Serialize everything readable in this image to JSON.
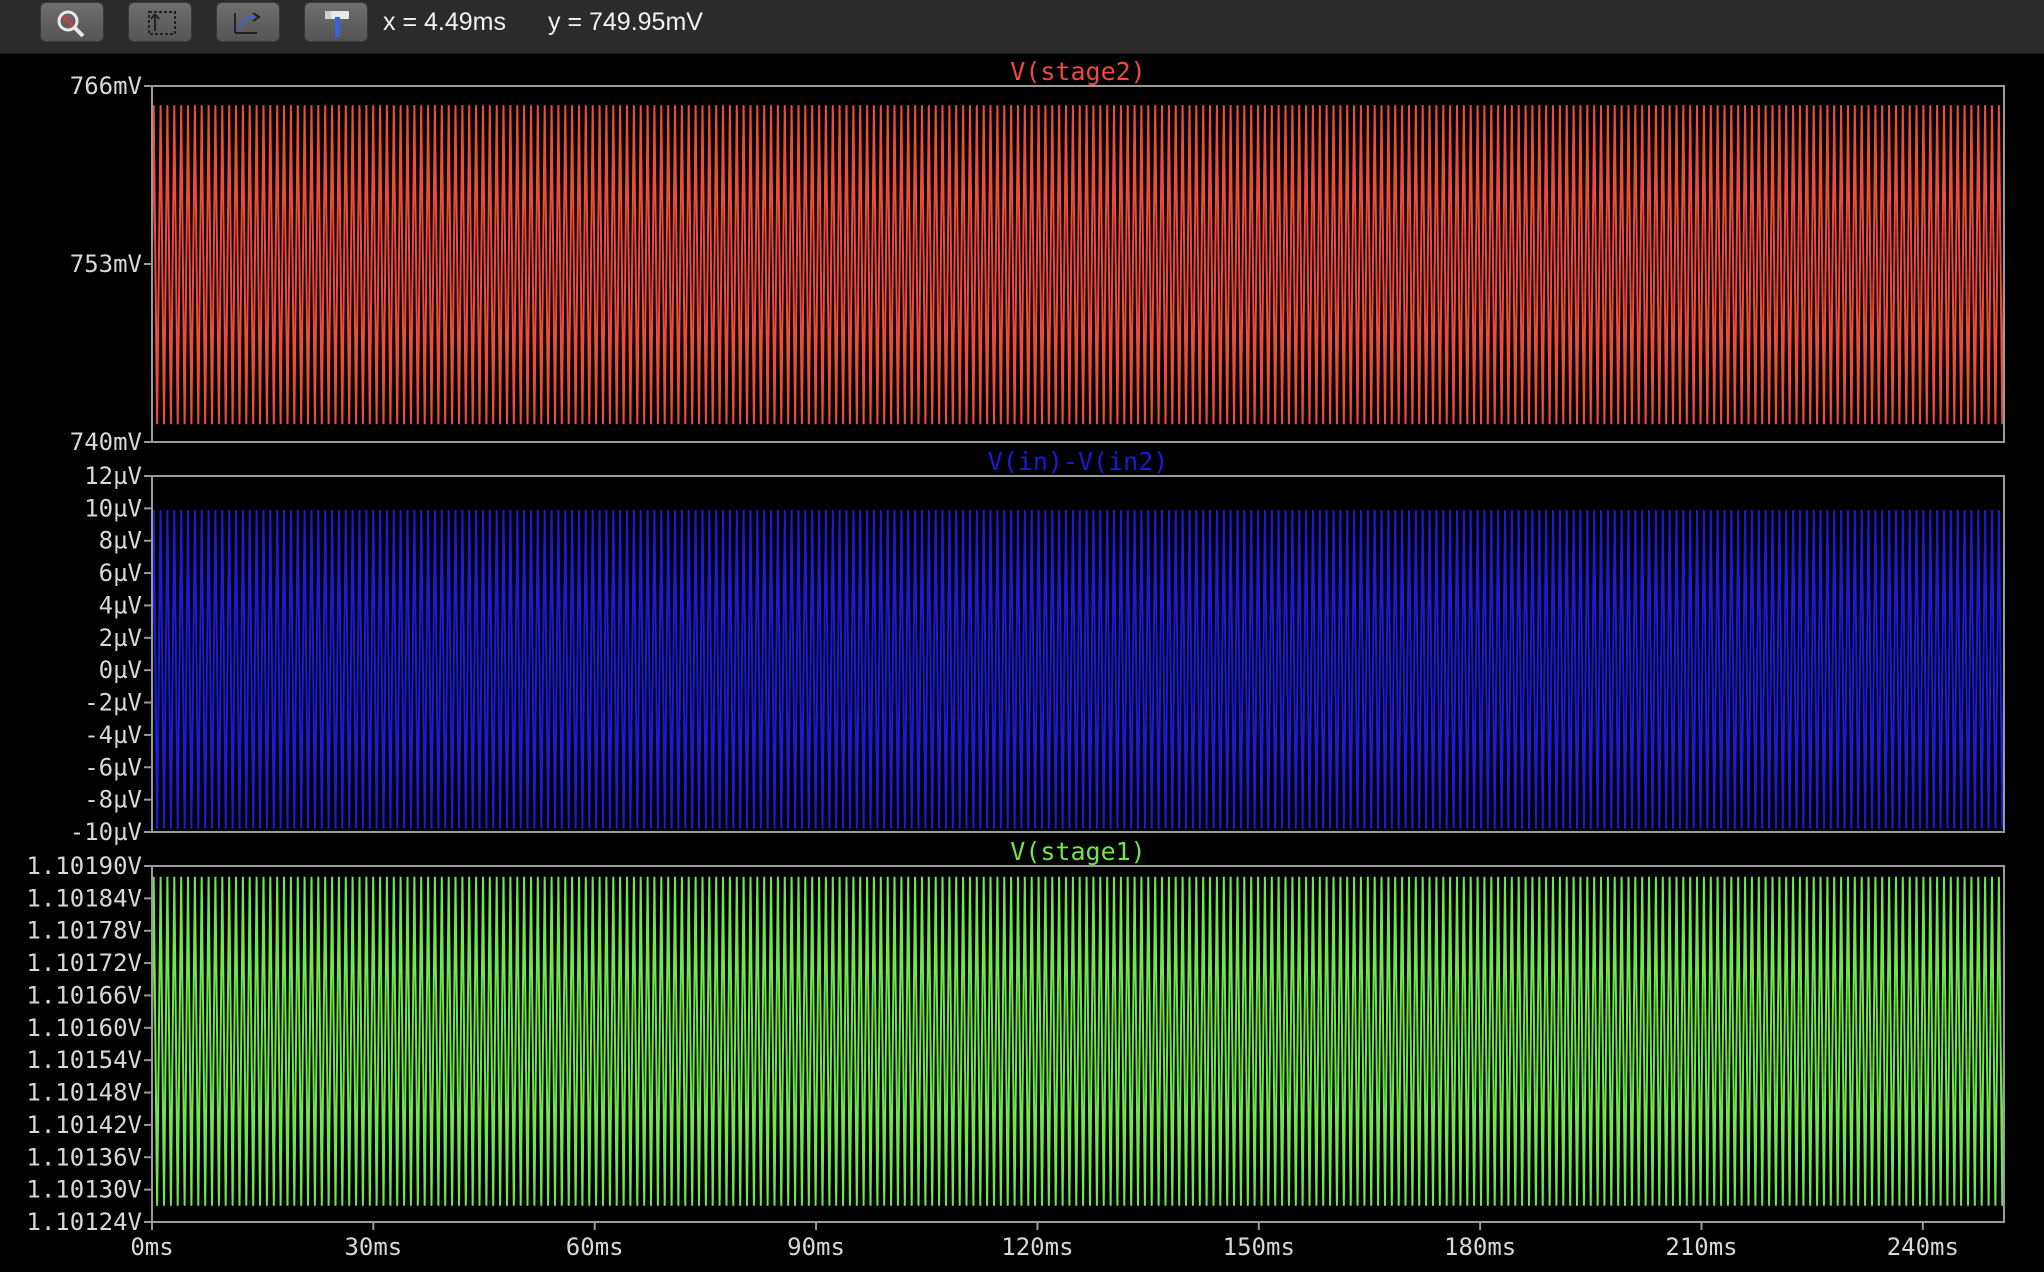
{
  "toolbar": {
    "buttons": [
      {
        "icon": "zoom-icon",
        "label": ""
      },
      {
        "icon": "autorange-icon",
        "label": ""
      },
      {
        "icon": "pan-icon",
        "label": ""
      },
      {
        "icon": "hammer-icon",
        "label": ""
      }
    ],
    "cursor_x": "x = 4.49ms",
    "cursor_y": "y = 749.95mV"
  },
  "chart_data": {
    "type": "line",
    "x_unit": "ms",
    "xlim": [
      0,
      251
    ],
    "x_ticks": [
      {
        "value": 0,
        "label": "0ms"
      },
      {
        "value": 30,
        "label": "30ms"
      },
      {
        "value": 60,
        "label": "60ms"
      },
      {
        "value": 90,
        "label": "90ms"
      },
      {
        "value": 120,
        "label": "120ms"
      },
      {
        "value": 150,
        "label": "150ms"
      },
      {
        "value": 180,
        "label": "180ms"
      },
      {
        "value": 210,
        "label": "210ms"
      },
      {
        "value": 240,
        "label": "240ms"
      }
    ],
    "periods_visible": 270,
    "grid": false,
    "panes": [
      {
        "title": "V(stage2)",
        "color": "#ef4a3c",
        "unit": "mV",
        "ylim": [
          740,
          766
        ],
        "y_ticks": [
          {
            "value": 766,
            "label": "766mV"
          },
          {
            "value": 753,
            "label": "753mV"
          },
          {
            "value": 740,
            "label": "740mV"
          }
        ],
        "signal_min": 741.3,
        "signal_max": 764.6
      },
      {
        "title": "V(in)-V(in2)",
        "color": "#1a1ad8",
        "unit": "µV",
        "ylim": [
          -10,
          12
        ],
        "y_ticks": [
          {
            "value": 12,
            "label": "12µV"
          },
          {
            "value": 10,
            "label": "10µV"
          },
          {
            "value": 8,
            "label": "8µV"
          },
          {
            "value": 6,
            "label": "6µV"
          },
          {
            "value": 4,
            "label": "4µV"
          },
          {
            "value": 2,
            "label": "2µV"
          },
          {
            "value": 0,
            "label": "0µV"
          },
          {
            "value": -2,
            "label": "-2µV"
          },
          {
            "value": -4,
            "label": "-4µV"
          },
          {
            "value": -6,
            "label": "-6µV"
          },
          {
            "value": -8,
            "label": "-8µV"
          },
          {
            "value": -10,
            "label": "-10µV"
          }
        ],
        "signal_min": -9.8,
        "signal_max": 9.9
      },
      {
        "title": "V(stage1)",
        "color": "#6fe64a",
        "unit": "V",
        "ylim": [
          1.10124,
          1.1019
        ],
        "y_ticks": [
          {
            "value": 1.1019,
            "label": "1.10190V"
          },
          {
            "value": 1.10184,
            "label": "1.10184V"
          },
          {
            "value": 1.10178,
            "label": "1.10178V"
          },
          {
            "value": 1.10172,
            "label": "1.10172V"
          },
          {
            "value": 1.10166,
            "label": "1.10166V"
          },
          {
            "value": 1.1016,
            "label": "1.10160V"
          },
          {
            "value": 1.10154,
            "label": "1.10154V"
          },
          {
            "value": 1.10148,
            "label": "1.10148V"
          },
          {
            "value": 1.10142,
            "label": "1.10142V"
          },
          {
            "value": 1.10136,
            "label": "1.10136V"
          },
          {
            "value": 1.1013,
            "label": "1.10130V"
          },
          {
            "value": 1.10124,
            "label": "1.10124V"
          }
        ],
        "signal_min": 1.10127,
        "signal_max": 1.10188
      }
    ]
  }
}
